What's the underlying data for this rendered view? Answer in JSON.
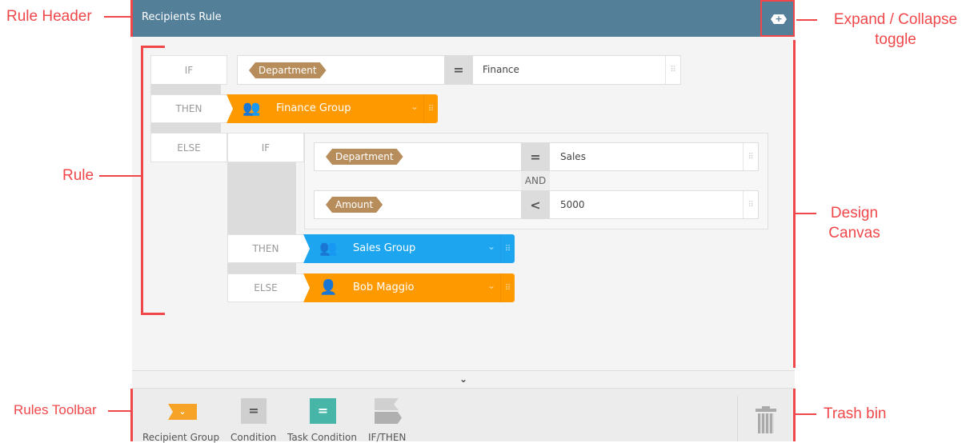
{
  "header": {
    "title": "Recipients Rule",
    "toggle_icon": "expand-collapse-icon"
  },
  "rule": {
    "labels": {
      "if": "IF",
      "then": "THEN",
      "else": "ELSE",
      "and": "AND"
    },
    "condition1": {
      "field": "Department",
      "operator": "=",
      "value": "Finance"
    },
    "then1": {
      "name": "Finance Group",
      "type": "group",
      "color": "#fe9a00"
    },
    "condition2": {
      "field": "Department",
      "operator": "=",
      "value": "Sales"
    },
    "condition3": {
      "field": "Amount",
      "operator": "<",
      "value": "5000"
    },
    "then2": {
      "name": "Sales Group",
      "type": "group",
      "color": "#1ea5ef"
    },
    "else2": {
      "name": "Bob Maggio",
      "type": "user",
      "color": "#fe9a00"
    }
  },
  "toolbar": {
    "items": [
      {
        "label": "Recipient Group"
      },
      {
        "label": "Condition"
      },
      {
        "label": "Task Condition"
      },
      {
        "label": "IF/THEN"
      }
    ],
    "trash_icon": "trash-icon"
  },
  "annotations": {
    "rule_header": "Rule Header",
    "expand_collapse": "Expand / Collapse toggle",
    "rule": "Rule",
    "design_canvas": "Design Canvas",
    "rules_toolbar": "Rules Toolbar",
    "trash_bin": "Trash bin"
  }
}
